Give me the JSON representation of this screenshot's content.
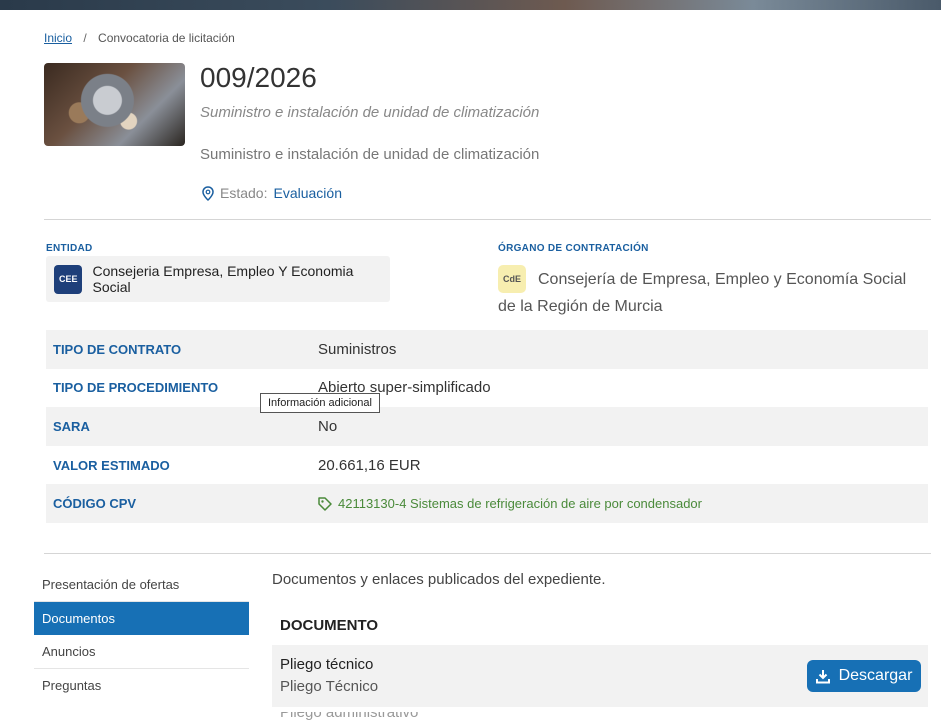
{
  "breadcrumb": {
    "home": "Inicio",
    "current": "Convocatoria de licitación"
  },
  "header": {
    "title": "009/2026",
    "subtitle_italic": "Suministro e instalación de unidad de climatización",
    "subtitle": "Suministro e instalación de unidad de climatización",
    "estado_label": "Estado:",
    "estado_value": "Evaluación"
  },
  "entidad": {
    "label": "ENTIDAD",
    "badge": "CEE",
    "name": "Consejeria Empresa, Empleo Y Economia Social"
  },
  "organo": {
    "label": "ÓRGANO DE CONTRATACIÓN",
    "badge": "CdE",
    "name": "Consejería de Empresa, Empleo y Economía Social de la Región de Murcia"
  },
  "properties": [
    {
      "key": "TIPO DE CONTRATO",
      "value": "Suministros"
    },
    {
      "key": "TIPO DE PROCEDIMIENTO",
      "value": "Abierto super-simplificado"
    },
    {
      "key": "SARA",
      "value": "No"
    },
    {
      "key": "VALOR ESTIMADO",
      "value": "20.661,16 EUR"
    },
    {
      "key": "CÓDIGO CPV",
      "value": "42113130-4 Sistemas de refrigeración de aire por condensador"
    }
  ],
  "tooltip": "Información adicional",
  "sidenav": {
    "items": [
      "Presentación de ofertas",
      "Documentos",
      "Anuncios",
      "Preguntas"
    ]
  },
  "documents": {
    "intro": "Documentos y enlaces publicados del expediente.",
    "header": "DOCUMENTO",
    "rows": [
      {
        "title": "Pliego técnico",
        "description": "Pliego Técnico",
        "button": "Descargar"
      }
    ],
    "next_partial": "Pliego administrativo"
  },
  "colors": {
    "accent": "#1770b5",
    "link": "#1a5fa0",
    "cpv": "#4a8a3a"
  }
}
